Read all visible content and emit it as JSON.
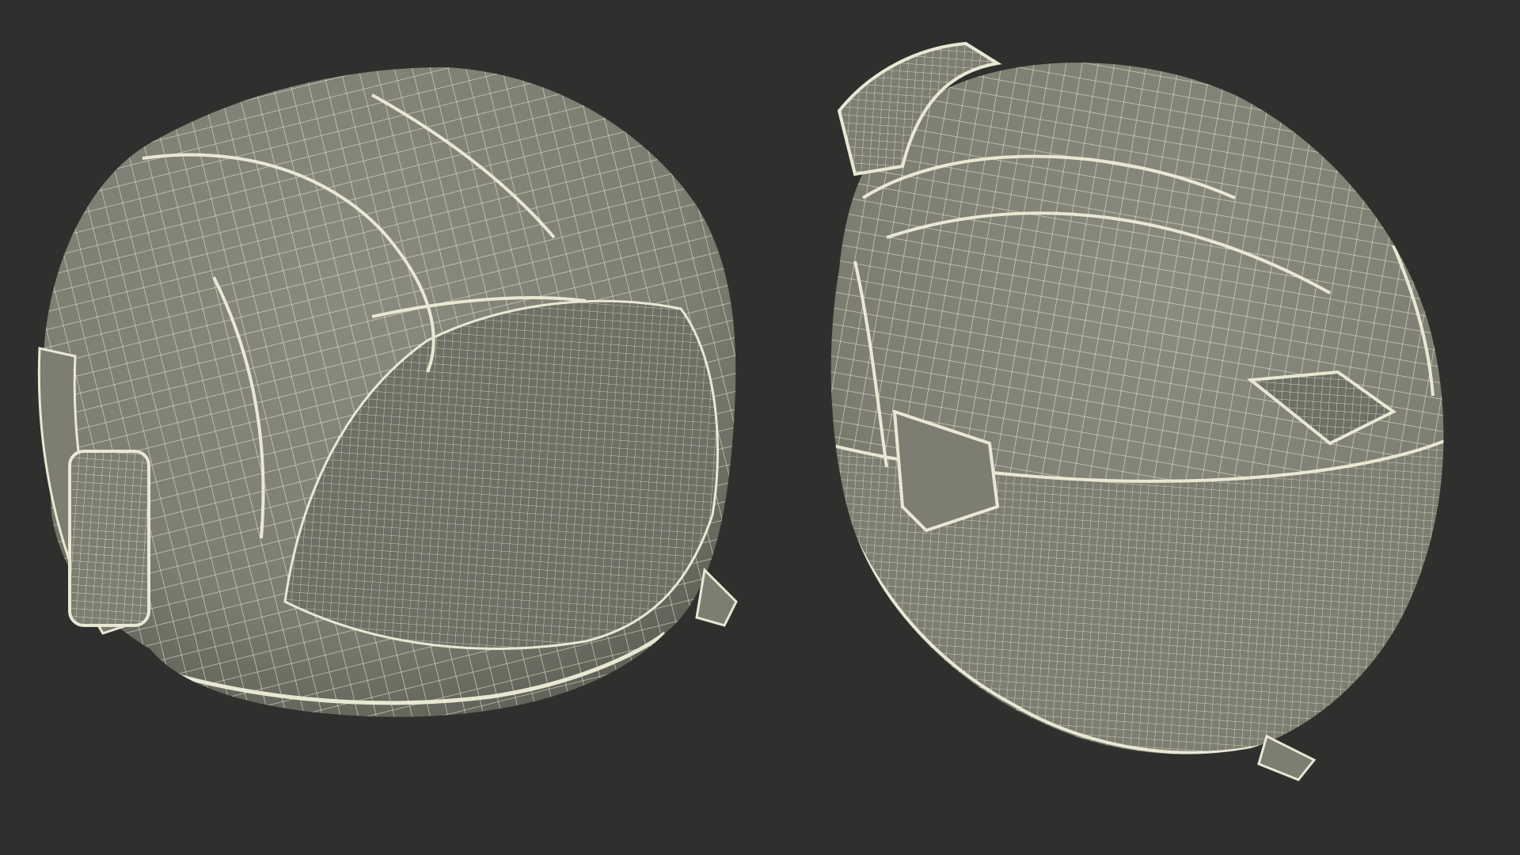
{
  "scene": {
    "background_color": "#2f302e",
    "mesh_surface_color": "#7d7e71",
    "mesh_wire_color": "#e8e8d4",
    "mesh_shadow_color": "#5f6056",
    "objects": [
      {
        "kind": "helmet-wireframe",
        "view": "rear-three-quarter"
      },
      {
        "kind": "helmet-wireframe",
        "view": "front-three-quarter"
      }
    ]
  }
}
